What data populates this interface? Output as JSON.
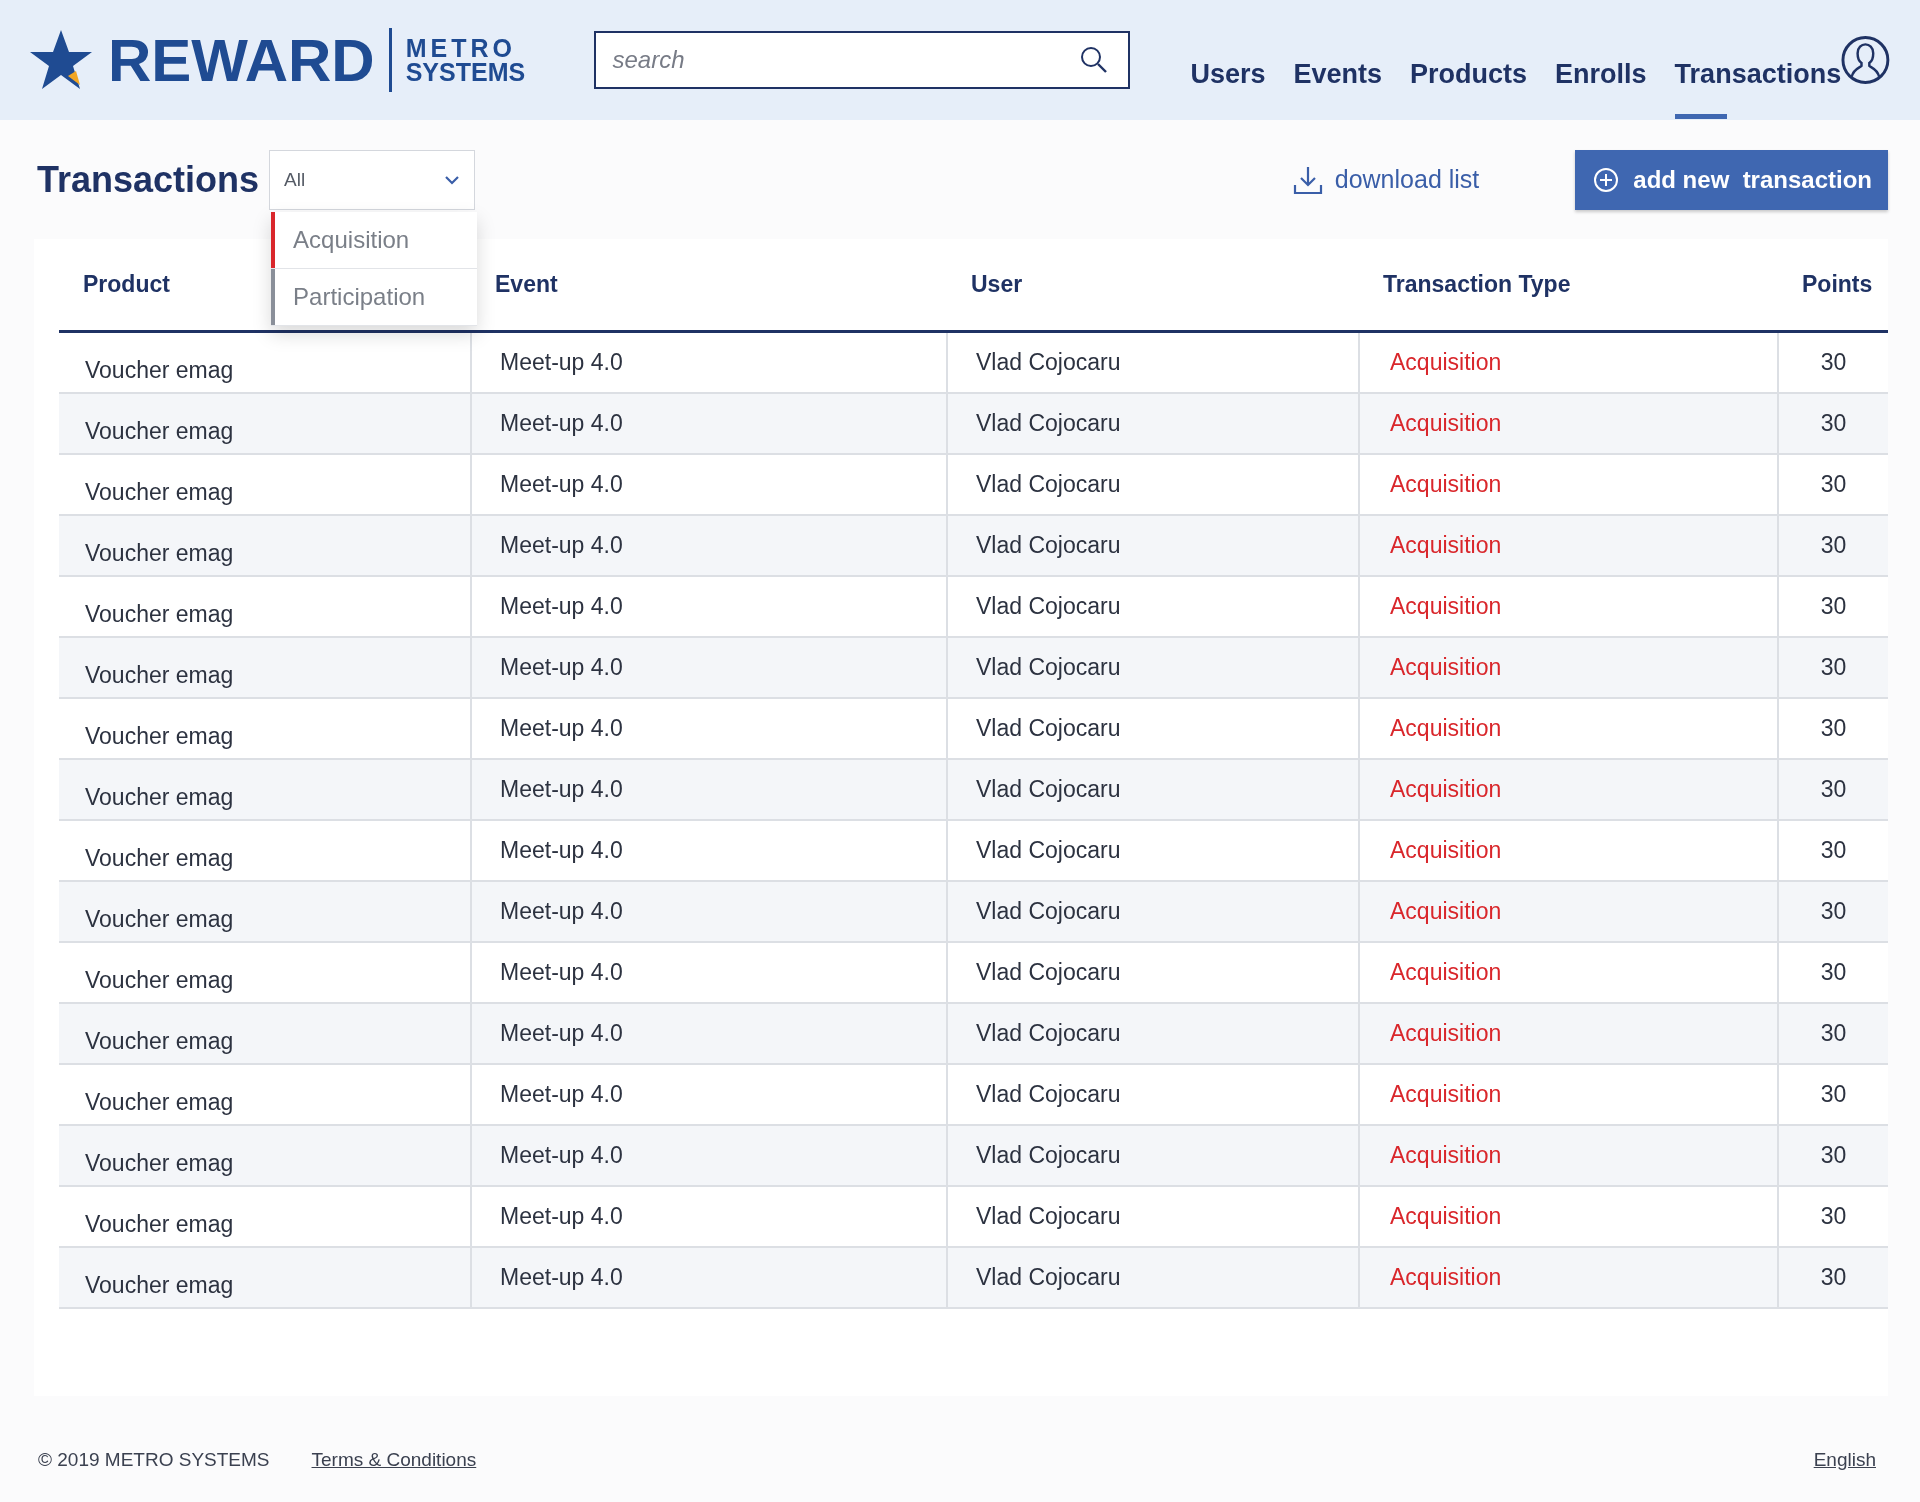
{
  "header": {
    "logo": {
      "title": "REWARD",
      "brand_top": "METRO",
      "brand_bottom": "SYSTEMS"
    },
    "search": {
      "placeholder": "search"
    },
    "nav": [
      {
        "label": "Users",
        "selected": false
      },
      {
        "label": "Events",
        "selected": false
      },
      {
        "label": "Products",
        "selected": false
      },
      {
        "label": "Enrolls",
        "selected": false
      },
      {
        "label": "Transactions",
        "selected": true
      }
    ]
  },
  "toolbar": {
    "title": "Transactions",
    "filter": {
      "value": "All",
      "expanded": true,
      "options": [
        {
          "label": "Acquisition",
          "color": "#d9262b"
        },
        {
          "label": "Participation",
          "color": "#8a8f99"
        }
      ]
    },
    "download": "download list",
    "add_button": "add new  transaction"
  },
  "table": {
    "columns": [
      "Product",
      "Event",
      "User",
      "Transaction Type",
      "Points"
    ],
    "rows": [
      [
        "Voucher emag",
        "Meet-up 4.0",
        "Vlad Cojocaru",
        "Acquisition",
        "30"
      ],
      [
        "Voucher emag",
        "Meet-up 4.0",
        "Vlad Cojocaru",
        "Acquisition",
        "30"
      ],
      [
        "Voucher emag",
        "Meet-up 4.0",
        "Vlad Cojocaru",
        "Acquisition",
        "30"
      ],
      [
        "Voucher emag",
        "Meet-up 4.0",
        "Vlad Cojocaru",
        "Acquisition",
        "30"
      ],
      [
        "Voucher emag",
        "Meet-up 4.0",
        "Vlad Cojocaru",
        "Acquisition",
        "30"
      ],
      [
        "Voucher emag",
        "Meet-up 4.0",
        "Vlad Cojocaru",
        "Acquisition",
        "30"
      ],
      [
        "Voucher emag",
        "Meet-up 4.0",
        "Vlad Cojocaru",
        "Acquisition",
        "30"
      ],
      [
        "Voucher emag",
        "Meet-up 4.0",
        "Vlad Cojocaru",
        "Acquisition",
        "30"
      ],
      [
        "Voucher emag",
        "Meet-up 4.0",
        "Vlad Cojocaru",
        "Acquisition",
        "30"
      ],
      [
        "Voucher emag",
        "Meet-up 4.0",
        "Vlad Cojocaru",
        "Acquisition",
        "30"
      ],
      [
        "Voucher emag",
        "Meet-up 4.0",
        "Vlad Cojocaru",
        "Acquisition",
        "30"
      ],
      [
        "Voucher emag",
        "Meet-up 4.0",
        "Vlad Cojocaru",
        "Acquisition",
        "30"
      ],
      [
        "Voucher emag",
        "Meet-up 4.0",
        "Vlad Cojocaru",
        "Acquisition",
        "30"
      ],
      [
        "Voucher emag",
        "Meet-up 4.0",
        "Vlad Cojocaru",
        "Acquisition",
        "30"
      ],
      [
        "Voucher emag",
        "Meet-up 4.0",
        "Vlad Cojocaru",
        "Acquisition",
        "30"
      ],
      [
        "Voucher emag",
        "Meet-up 4.0",
        "Vlad Cojocaru",
        "Acquisition",
        "30"
      ]
    ]
  },
  "footer": {
    "copyright": "© 2019 METRO SYSTEMS",
    "terms": "Terms & Conditions",
    "language": "English"
  }
}
